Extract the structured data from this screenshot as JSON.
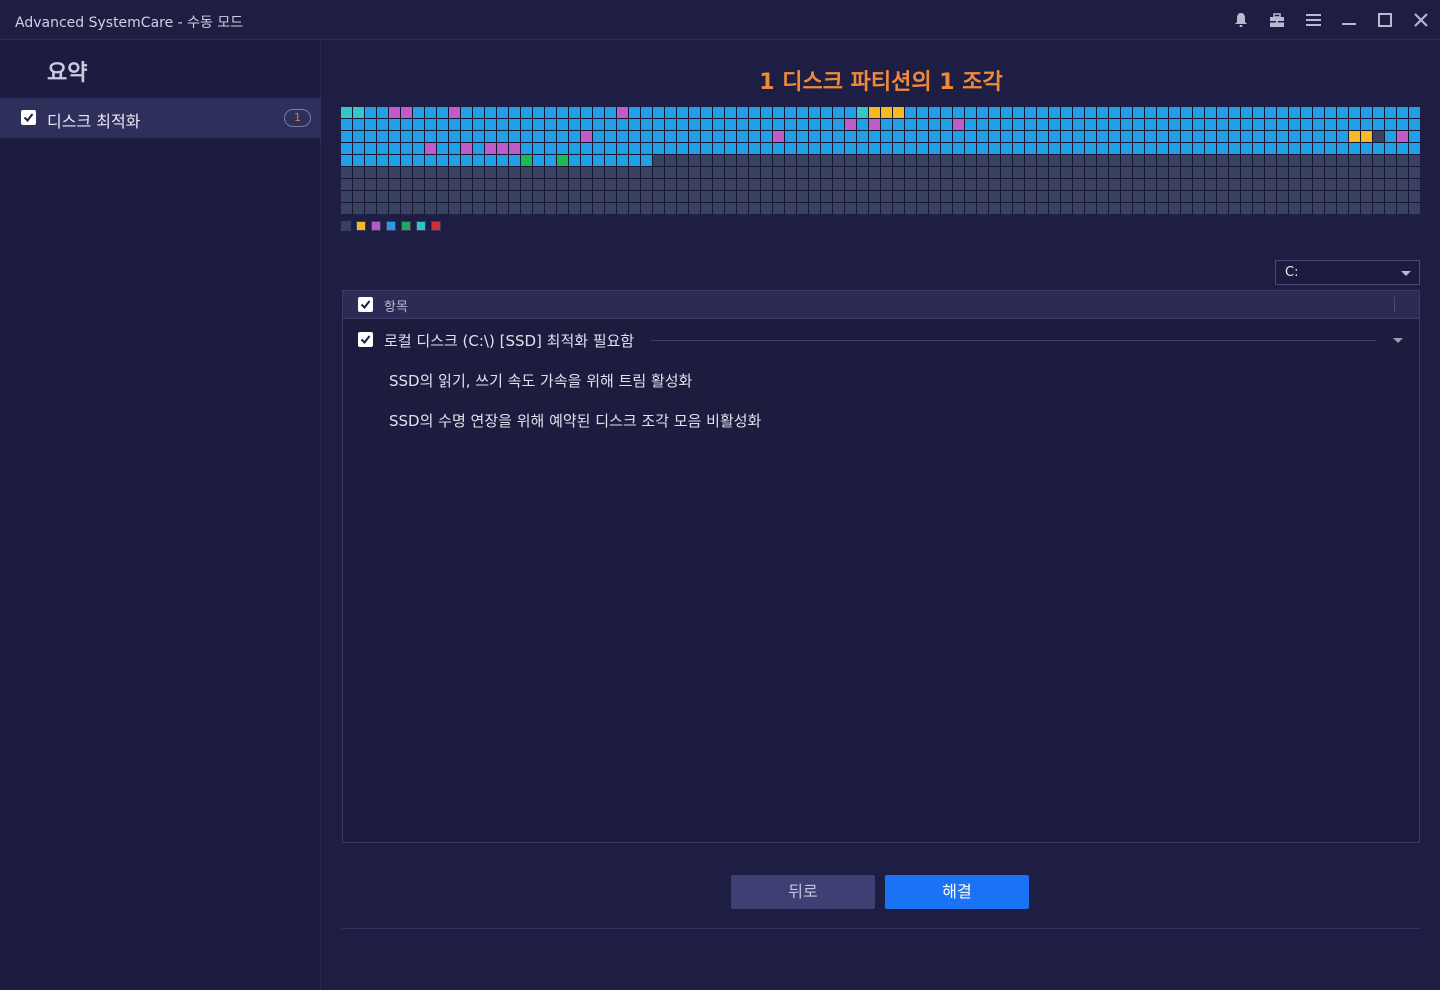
{
  "window": {
    "title": "Advanced SystemCare - 수동 모드",
    "icons": [
      "bell-icon",
      "toolbox-icon",
      "menu-icon",
      "minimize-icon",
      "maximize-icon",
      "close-icon"
    ]
  },
  "sidebar": {
    "heading": "요약",
    "items": [
      {
        "label": "디스크 최적화",
        "checked": true,
        "count": "1"
      }
    ]
  },
  "main": {
    "headline": "1 디스크 파티션의 1 조각",
    "drive_select": {
      "value": "C:"
    },
    "legend_colors": [
      "#3b4060",
      "#f5b921",
      "#b85bc8",
      "#2a9ae6",
      "#1faa55",
      "#2ec3c8",
      "#d03030"
    ],
    "disk_map": {
      "columns": 90,
      "rows": 9,
      "colors": {
        "used": "#21a0e8",
        "free": "#3a4262",
        "fragmented": "#c05cc8",
        "system": "#f5b921",
        "mft": "#1db954",
        "pagefile": "#34c6c8",
        "unmovable": "#3a4262"
      }
    },
    "table": {
      "header_label": "항목",
      "header_checked": true,
      "group": {
        "label": "로컬 디스크 (C:\\) [SSD] 최적화 필요함",
        "checked": true
      },
      "details": [
        "SSD의 읽기, 쓰기 속도 가속을 위해 트림 활성화",
        "SSD의 수명 연장을 위해 예약된 디스크 조각 모음 비활성화"
      ]
    },
    "buttons": {
      "back": "뒤로",
      "fix": "해결"
    }
  }
}
